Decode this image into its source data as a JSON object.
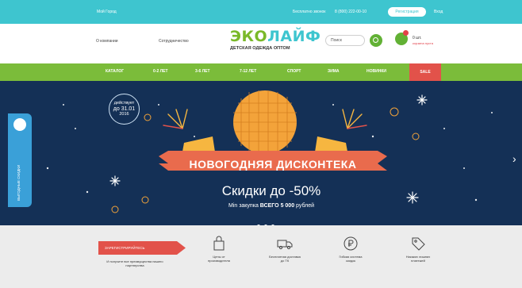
{
  "topbar": {
    "city": "Мой Город",
    "center_text": "Бесплатно звонок",
    "phone": "8 (800) 222-00-10",
    "register": "Регистрация",
    "login": "Вход"
  },
  "header": {
    "menu1": "О компании",
    "menu2": "Сотрудничество",
    "logo_part1": "ЭКО",
    "logo_part2": "ЛАЙФ",
    "logo_tagline": "ДЕТСКАЯ ОДЕЖДА ОПТОМ",
    "search_placeholder": "Поиск",
    "cart_label": "0 шт.",
    "cart_sub": "корзина пуста"
  },
  "nav": {
    "items": [
      "КАТАЛОГ",
      "0-2 ЛЕТ",
      "3-6 ЛЕТ",
      "7-12 ЛЕТ",
      "СПОРТ",
      "ЗИМА",
      "НОВИНКИ"
    ],
    "sale": "SALE"
  },
  "banner": {
    "badge_line1": "действует",
    "badge_line2": "до 31.01",
    "badge_line3": "2016",
    "ribbon": "НОВОГОДНЯЯ ДИСКОНТЕКА",
    "discount": "Скидки до -50%",
    "min_order_prefix": "Min закупка",
    "min_order_value": "ВСЕГО 5 000",
    "min_order_suffix": "рублей",
    "side_tab": "ВЫГОДНЫЕ СКИДКИ"
  },
  "features": {
    "cta": "ЗАРЕГИСТРИРУЙТЕСЬ",
    "cta_sub": "И получите все преимущества нашего партнерства",
    "items": [
      {
        "icon": "shopping-bag-icon",
        "label": "Цены от производителя"
      },
      {
        "icon": "truck-icon",
        "label": "Бесплатная доставка до ТК"
      },
      {
        "icon": "ruble-coin-icon",
        "label": "Гибкая система скидок"
      },
      {
        "icon": "tag-icon",
        "label": "Никаких лишних платежей"
      }
    ]
  },
  "colors": {
    "topbar": "#3ec5cf",
    "nav": "#7bbc3a",
    "sale": "#e2524a",
    "banner": "#143056"
  }
}
